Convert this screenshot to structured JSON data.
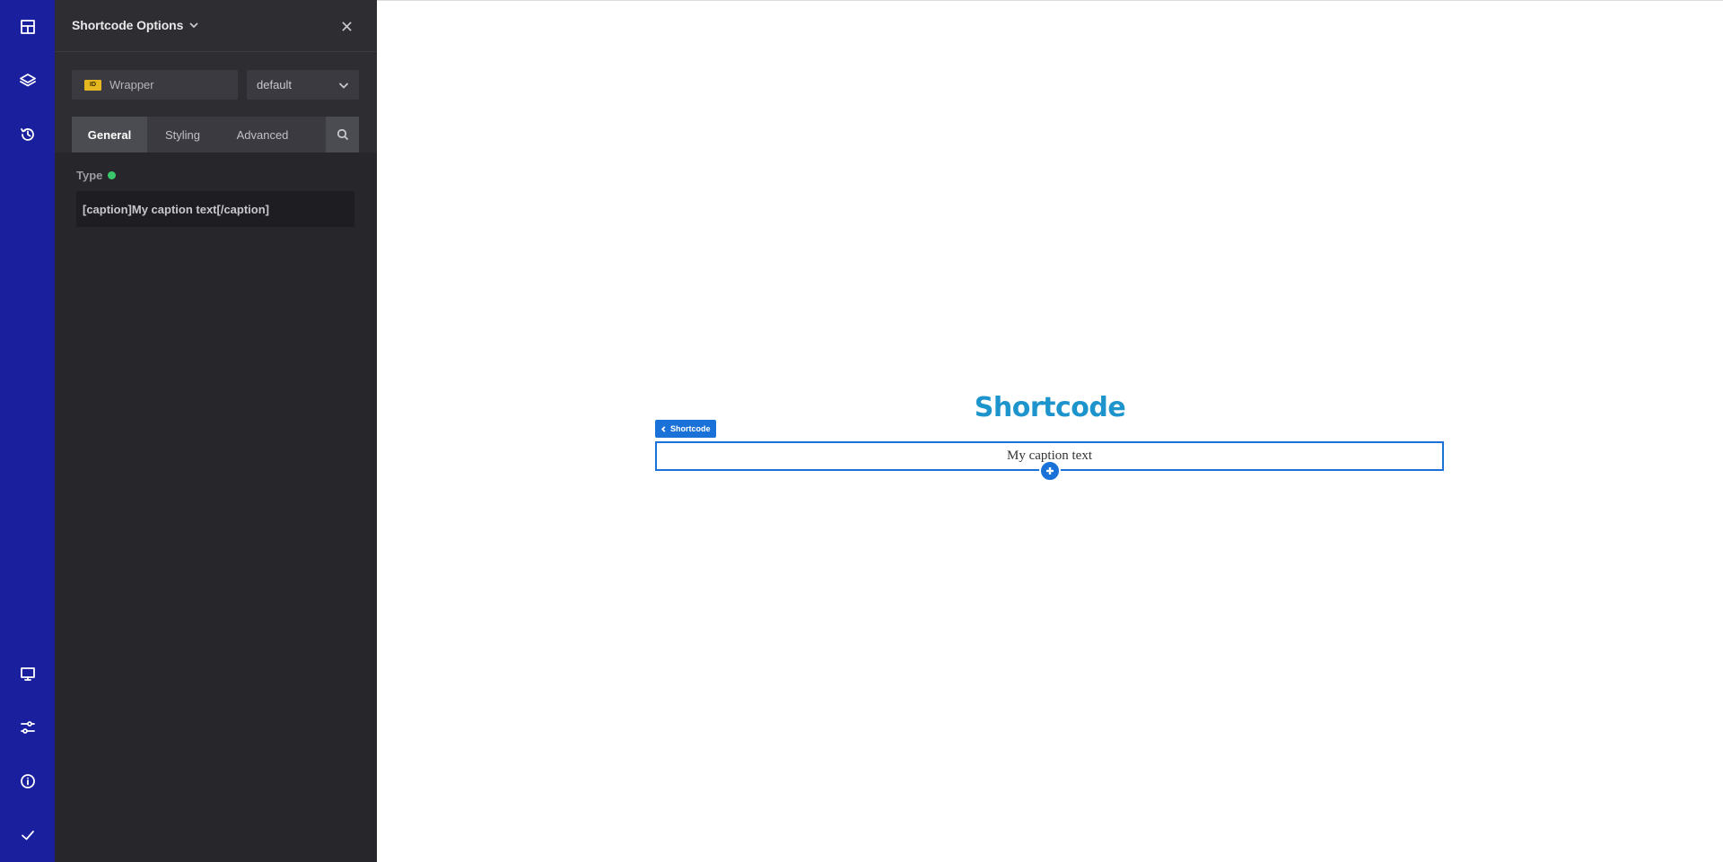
{
  "rail": {
    "top_icons": [
      "layout-icon",
      "layers-icon",
      "history-icon"
    ],
    "bottom_icons": [
      "desktop-icon",
      "sliders-icon",
      "info-icon",
      "check-icon"
    ]
  },
  "panel": {
    "title": "Shortcode Options",
    "wrapper": {
      "badge": "ID",
      "label": "Wrapper"
    },
    "preset_select": {
      "value": "default"
    },
    "tabs": [
      {
        "label": "General",
        "active": true
      },
      {
        "label": "Styling",
        "active": false
      },
      {
        "label": "Advanced",
        "active": false
      }
    ],
    "type_field": {
      "label": "Type",
      "value": "[caption]My caption text[/caption]"
    }
  },
  "canvas": {
    "heading": "Shortcode",
    "element_tag": "Shortcode",
    "shortcode_output": "My caption text"
  },
  "colors": {
    "rail_bg": "#1a1f9e",
    "panel_bg": "#2d2d32",
    "accent": "#1a72d8",
    "heading": "#1d95cc",
    "status_dot": "#3ac66a",
    "id_badge": "#e6b820"
  }
}
